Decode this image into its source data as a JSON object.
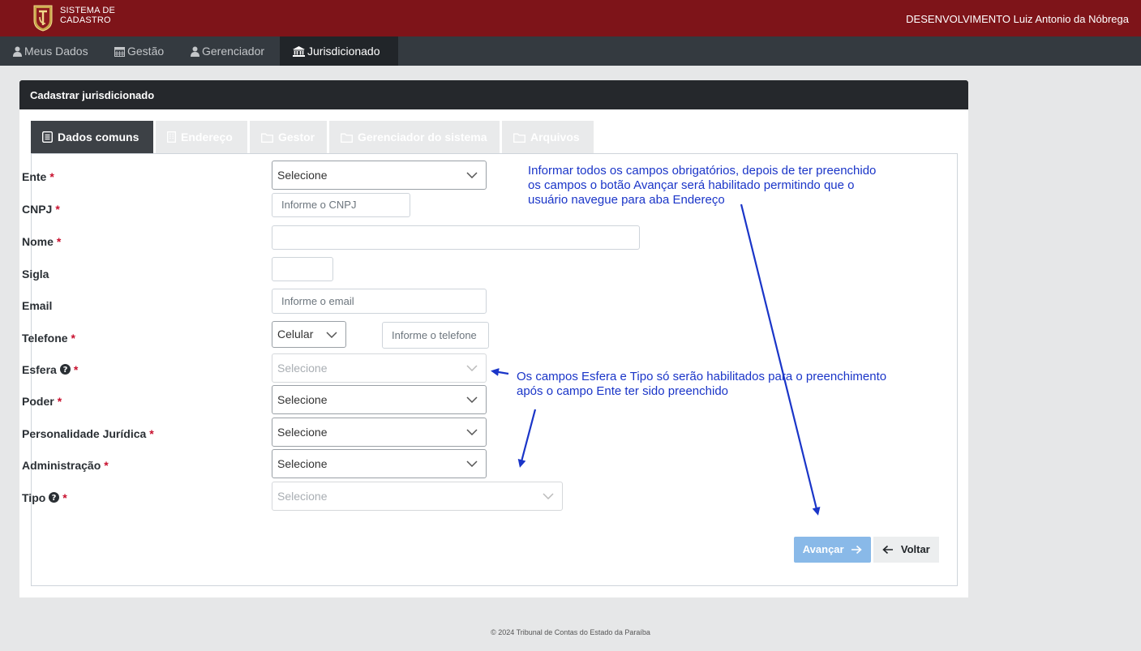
{
  "header": {
    "logo_line1": "SISTEMA DE",
    "logo_line2": "CADASTRO",
    "user": "DESENVOLVIMENTO Luiz Antonio da Nóbrega",
    "brand_color": "#7e1419"
  },
  "nav": {
    "items": [
      {
        "label": "Meus Dados",
        "icon": "user-icon"
      },
      {
        "label": "Gestão",
        "icon": "calendar-icon"
      },
      {
        "label": "Gerenciador",
        "icon": "user-icon"
      },
      {
        "label": "Jurisdicionado",
        "icon": "institution-icon",
        "active": true
      }
    ]
  },
  "card": {
    "title": "Cadastrar jurisdicionado",
    "tabs": [
      {
        "label": "Dados comuns",
        "icon": "list-icon",
        "active": true
      },
      {
        "label": "Endereço",
        "icon": "building-icon"
      },
      {
        "label": "Gestor",
        "icon": "folder-icon"
      },
      {
        "label": "Gerenciador do sistema",
        "icon": "folder-icon"
      },
      {
        "label": "Arquivos",
        "icon": "folder-icon"
      }
    ]
  },
  "form": {
    "required_mark": "*",
    "ente": {
      "label": "Ente",
      "value": "Selecione"
    },
    "cnpj": {
      "label": "CNPJ",
      "placeholder": "Informe o CNPJ"
    },
    "nome": {
      "label": "Nome",
      "value": ""
    },
    "sigla": {
      "label": "Sigla",
      "value": ""
    },
    "email": {
      "label": "Email",
      "placeholder": "Informe o email"
    },
    "telefone": {
      "label": "Telefone",
      "type_value": "Celular",
      "placeholder": "Informe o telefone"
    },
    "esfera": {
      "label": "Esfera",
      "value": "Selecione",
      "disabled": true
    },
    "poder": {
      "label": "Poder",
      "value": "Selecione"
    },
    "personalidade": {
      "label": "Personalidade Jurídica",
      "value": "Selecione"
    },
    "administracao": {
      "label": "Administração",
      "value": "Selecione"
    },
    "tipo": {
      "label": "Tipo",
      "value": "Selecione",
      "disabled": true
    }
  },
  "buttons": {
    "next": "Avançar",
    "back": "Voltar"
  },
  "annotations": {
    "note1_line1": "Informar todos os campos obrigatórios, depois de ter preenchido",
    "note1_line2": "os campos o botão Avançar será habilitado permitindo que o",
    "note1_line3": "usuário navegue para aba Endereço",
    "note2_line1": "Os campos Esfera e Tipo só serão habilitados para o preenchimento",
    "note2_line2": "após o campo Ente ter sido preenchido",
    "color": "#1a35c8"
  },
  "footer": {
    "text": "© 2024 Tribunal de Contas do Estado da Paraíba"
  }
}
